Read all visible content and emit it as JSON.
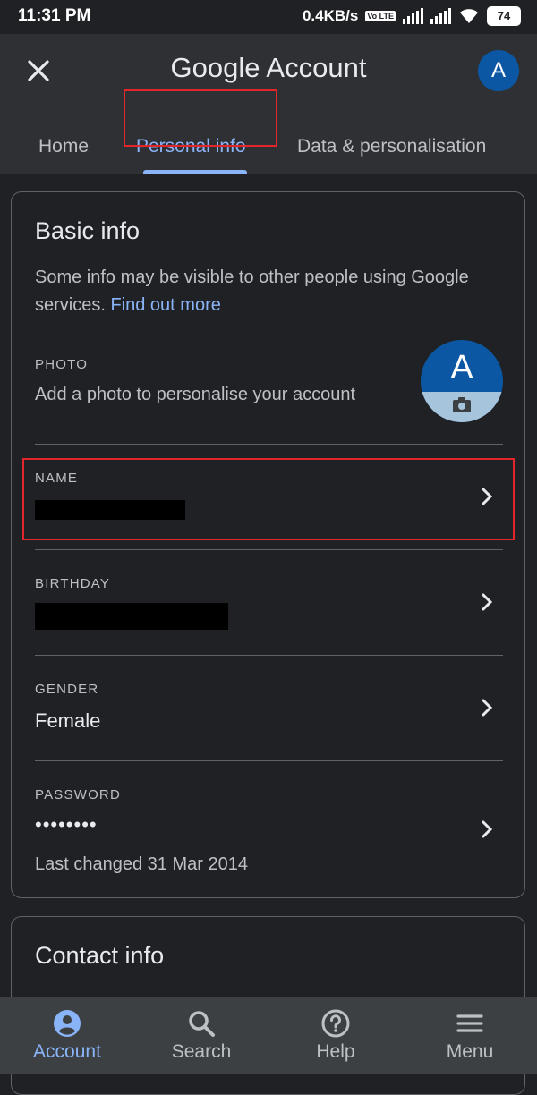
{
  "status_bar": {
    "time": "11:31 PM",
    "net_speed": "0.4KB/s",
    "volte": "Vo LTE",
    "battery": "74"
  },
  "header": {
    "title_brand": "Google",
    "title_rest": " Account",
    "avatar_letter": "A",
    "close_icon": "close-icon"
  },
  "tabs": [
    {
      "label": "Home"
    },
    {
      "label": "Personal info",
      "active": true
    },
    {
      "label": "Data & personalisation"
    }
  ],
  "basic_info": {
    "title": "Basic info",
    "intro": "Some info may be visible to other people using Google services.",
    "intro_link": "Find out more",
    "photo": {
      "label": "PHOTO",
      "description": "Add a photo to personalise your account",
      "avatar_letter": "A"
    },
    "name": {
      "label": "NAME"
    },
    "birthday": {
      "label": "BIRTHDAY"
    },
    "gender": {
      "label": "GENDER",
      "value": "Female"
    },
    "password": {
      "label": "PASSWORD",
      "value": "••••••••",
      "last_changed": "Last changed 31 Mar 2014"
    }
  },
  "contact_info": {
    "title": "Contact info"
  },
  "bottom_nav": [
    {
      "label": "Account",
      "icon": "account-circle-icon",
      "active": true
    },
    {
      "label": "Search",
      "icon": "search-icon"
    },
    {
      "label": "Help",
      "icon": "help-icon"
    },
    {
      "label": "Menu",
      "icon": "menu-icon"
    }
  ],
  "colors": {
    "background": "#202124",
    "header": "#2f3033",
    "accent": "#8ab4f8",
    "highlight": "#e3262c",
    "nav_bar": "#3c4043"
  }
}
